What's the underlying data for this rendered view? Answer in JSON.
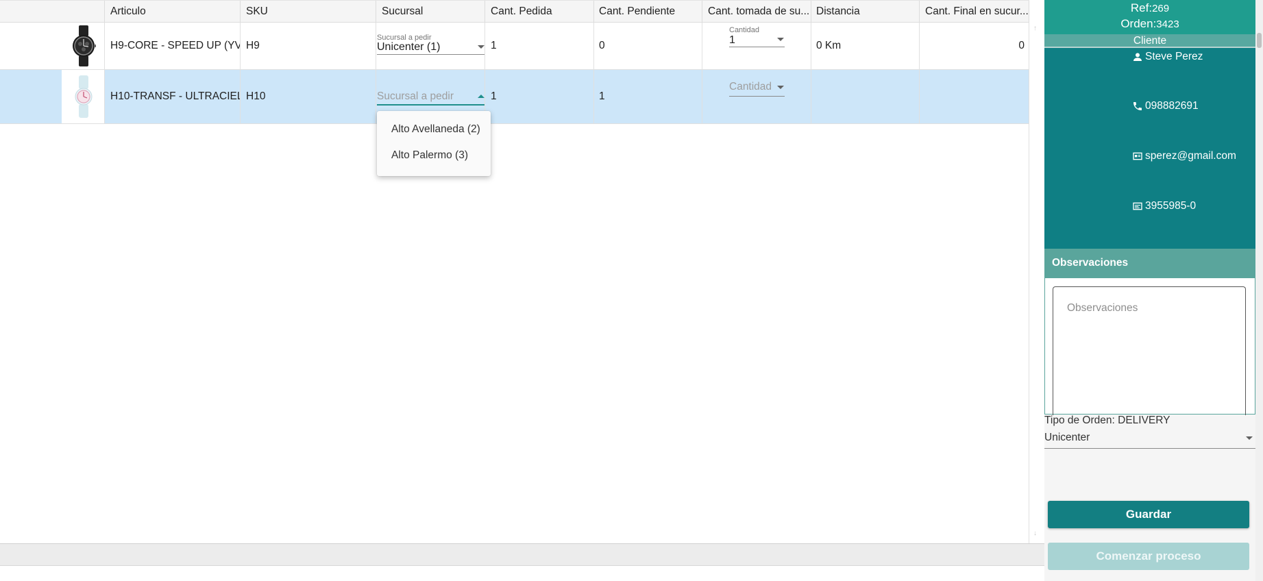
{
  "table": {
    "columns": [
      "Articulo",
      "SKU",
      "Sucursal",
      "Cant. Pedida",
      "Cant. Pendiente",
      "Cant. tomada de su...",
      "Distancia",
      "Cant. Final en sucur..."
    ],
    "rows": [
      {
        "image": "watch-black-thumbnail",
        "articulo": "H9-CORE - SPEED UP (YV...",
        "sku": "H9",
        "sucursal_label": "Sucursal a pedir",
        "sucursal_value": "Unicenter (1)",
        "cant_pedida": "1",
        "cant_pendiente": "0",
        "cantidad_label": "Cantidad",
        "cantidad_value": "1",
        "distancia": "0 Km",
        "cant_final": "0"
      },
      {
        "image": "watch-pastel-thumbnail",
        "articulo": "H10-TRANSF - ULTRACIEL...",
        "sku": "H10",
        "sucursal_placeholder": "Sucursal a pedir",
        "cant_pedida": "1",
        "cant_pendiente": "1",
        "cantidad_placeholder": "Cantidad",
        "distancia": "",
        "cant_final": ""
      }
    ]
  },
  "dropdown": {
    "options": [
      "Alto Avellaneda (2)",
      "Alto Palermo (3)"
    ]
  },
  "order": {
    "ref_label": "Ref:",
    "ref_value": "269",
    "orden_label": "Orden:",
    "orden_value": "3423"
  },
  "client": {
    "title": "Cliente",
    "name": "Steve Perez",
    "phone": "098882691",
    "email": "sperez@gmail.com",
    "document": "3955985-0"
  },
  "observaciones": {
    "title": "Observaciones",
    "placeholder": "Observaciones"
  },
  "tipo_orden": "Tipo de Orden: DELIVERY",
  "sucursal_selected": "Unicenter",
  "buttons": {
    "save": "Guardar",
    "start": "Comenzar proceso"
  },
  "colors": {
    "teal_dark": "#0f7f84",
    "teal_header": "#1f9d8f",
    "row_selected": "#cde6f9",
    "button_disabled": "#a8d3d3"
  }
}
